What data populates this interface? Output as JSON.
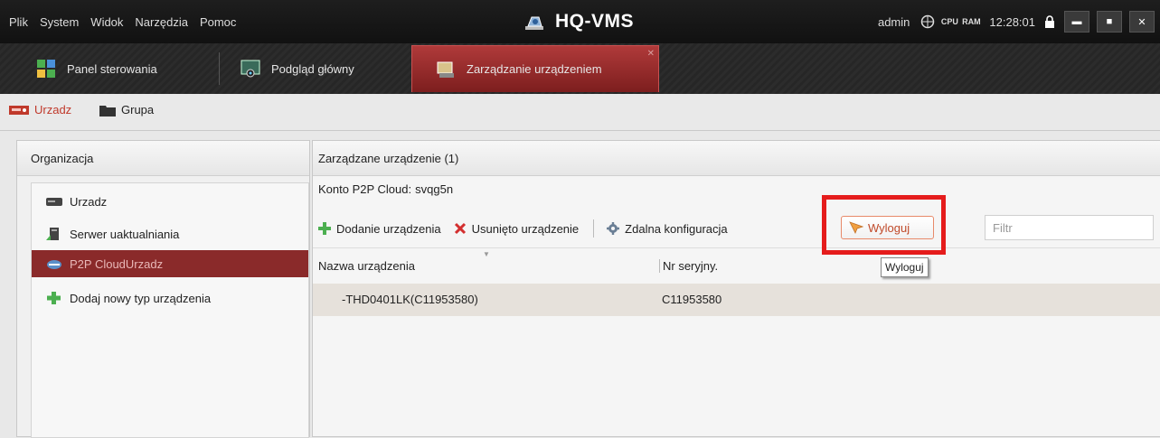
{
  "menu": [
    "Plik",
    "System",
    "Widok",
    "Narzędzia",
    "Pomoc"
  ],
  "app_title": "HQ-VMS",
  "status": {
    "user": "admin",
    "cpu_label": "CPU",
    "ram_label": "RAM",
    "time": "12:28:01"
  },
  "main_tabs": [
    {
      "label": "Panel sterowania",
      "active": false
    },
    {
      "label": "Podgląd główny",
      "active": false
    },
    {
      "label": "Zarządzanie urządzeniem",
      "active": true
    }
  ],
  "sub_tabs": [
    {
      "label": "Urzadz",
      "active": true
    },
    {
      "label": "Grupa",
      "active": false
    }
  ],
  "left_panel": {
    "title": "Organizacja",
    "items": [
      {
        "label": "Urzadz",
        "icon": "device-icon",
        "selected": false
      },
      {
        "label": "Serwer uaktualniania",
        "icon": "server-icon",
        "selected": false
      },
      {
        "label": "P2P CloudUrzadz",
        "icon": "cloud-device-icon",
        "selected": true
      },
      {
        "label": "Dodaj nowy typ urządzenia",
        "icon": "plus-icon",
        "selected": false
      }
    ]
  },
  "right_panel": {
    "title": "Zarządzane urządzenie (1)",
    "cloud_account_label": "Konto P2P Cloud:",
    "cloud_account_value": "svqg5n",
    "toolbar": {
      "add": "Dodanie urządzenia",
      "delete": "Usunięto urządzenie",
      "remote_config": "Zdalna konfiguracja",
      "logout": "Wyloguj"
    },
    "filter_placeholder": "Filtr",
    "columns": [
      "Nazwa urządzenia",
      "Nr seryjny."
    ],
    "rows": [
      {
        "name": "-THD0401LK(C11953580)",
        "serial": "C11953580"
      }
    ],
    "tooltip": "Wyloguj"
  },
  "colors": {
    "accent": "#b03a3a",
    "highlight": "#e51c1c",
    "selected_row": "#8a2a2a"
  }
}
